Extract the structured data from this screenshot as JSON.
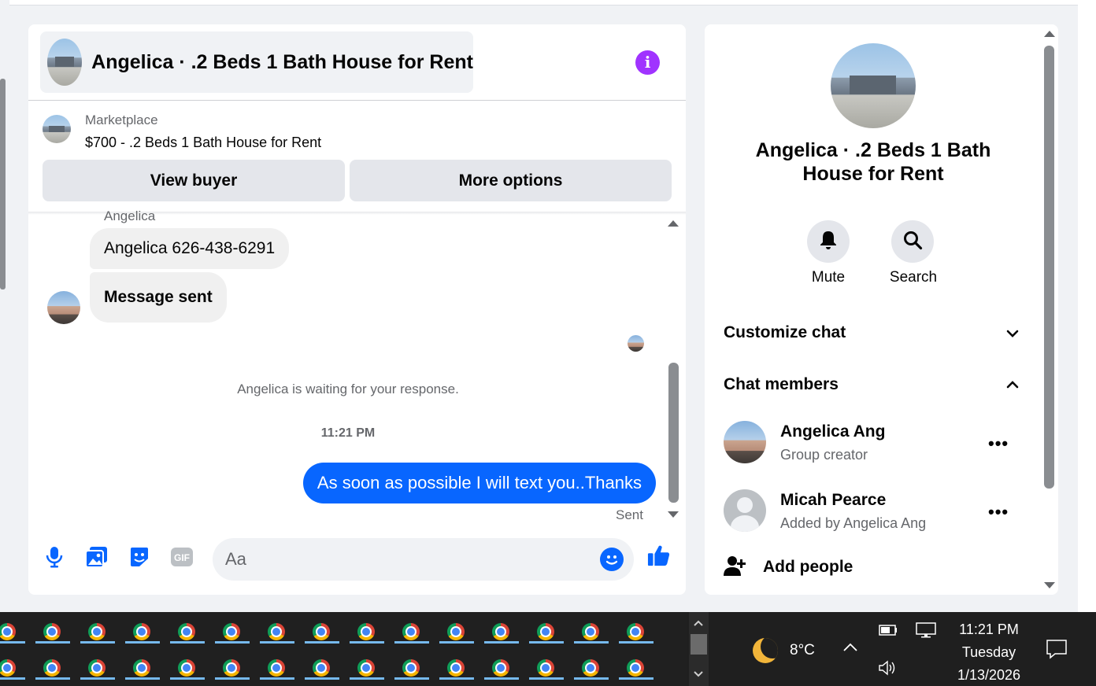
{
  "chat": {
    "title": "Angelica · .2 Beds 1 Bath House for Rent",
    "info_icon": "info-icon",
    "marketplace": {
      "label": "Marketplace",
      "item": "$700 - .2 Beds 1 Bath House for Rent"
    },
    "buttons": {
      "view_buyer": "View buyer",
      "more_options": "More options"
    },
    "messages": {
      "sender_name": "Angelica",
      "incoming": [
        "Angelica 626-438-6291",
        "Message sent"
      ],
      "waiting_notice": "Angelica is waiting for your response.",
      "timestamp": "11:21 PM",
      "outgoing": "As soon as possible I will text you..Thanks",
      "status": "Sent"
    },
    "composer": {
      "placeholder": "Aa",
      "icons": [
        "microphone-icon",
        "photo-icon",
        "sticker-icon",
        "gif-icon",
        "emoji-icon",
        "thumbs-up-icon"
      ],
      "gif_label": "GIF"
    }
  },
  "details": {
    "title": "Angelica · .2 Beds 1 Bath House for Rent",
    "actions": [
      {
        "label": "Mute",
        "icon": "bell-icon"
      },
      {
        "label": "Search",
        "icon": "search-icon"
      }
    ],
    "sections": {
      "customize": "Customize chat",
      "members": "Chat members"
    },
    "members": [
      {
        "name": "Angelica Ang",
        "role": "Group creator"
      },
      {
        "name": "Micah Pearce",
        "role": "Added by Angelica Ang"
      }
    ],
    "add_people": "Add people",
    "more_glyph": "•••"
  },
  "taskbar": {
    "app_icon": "chrome-icon",
    "weather": {
      "temp": "8°C",
      "icon": "moon-icon"
    },
    "clock": {
      "time": "11:21 PM",
      "day": "Tuesday",
      "date": "1/13/2026"
    },
    "tray_icons": [
      "chevron-up-icon",
      "battery-icon",
      "network-icon",
      "volume-icon",
      "notification-icon"
    ]
  },
  "colors": {
    "accent": "#0866ff",
    "info": "#a033ff",
    "bubble_in": "#f0f0f0",
    "panel_bg": "#f0f2f5"
  }
}
